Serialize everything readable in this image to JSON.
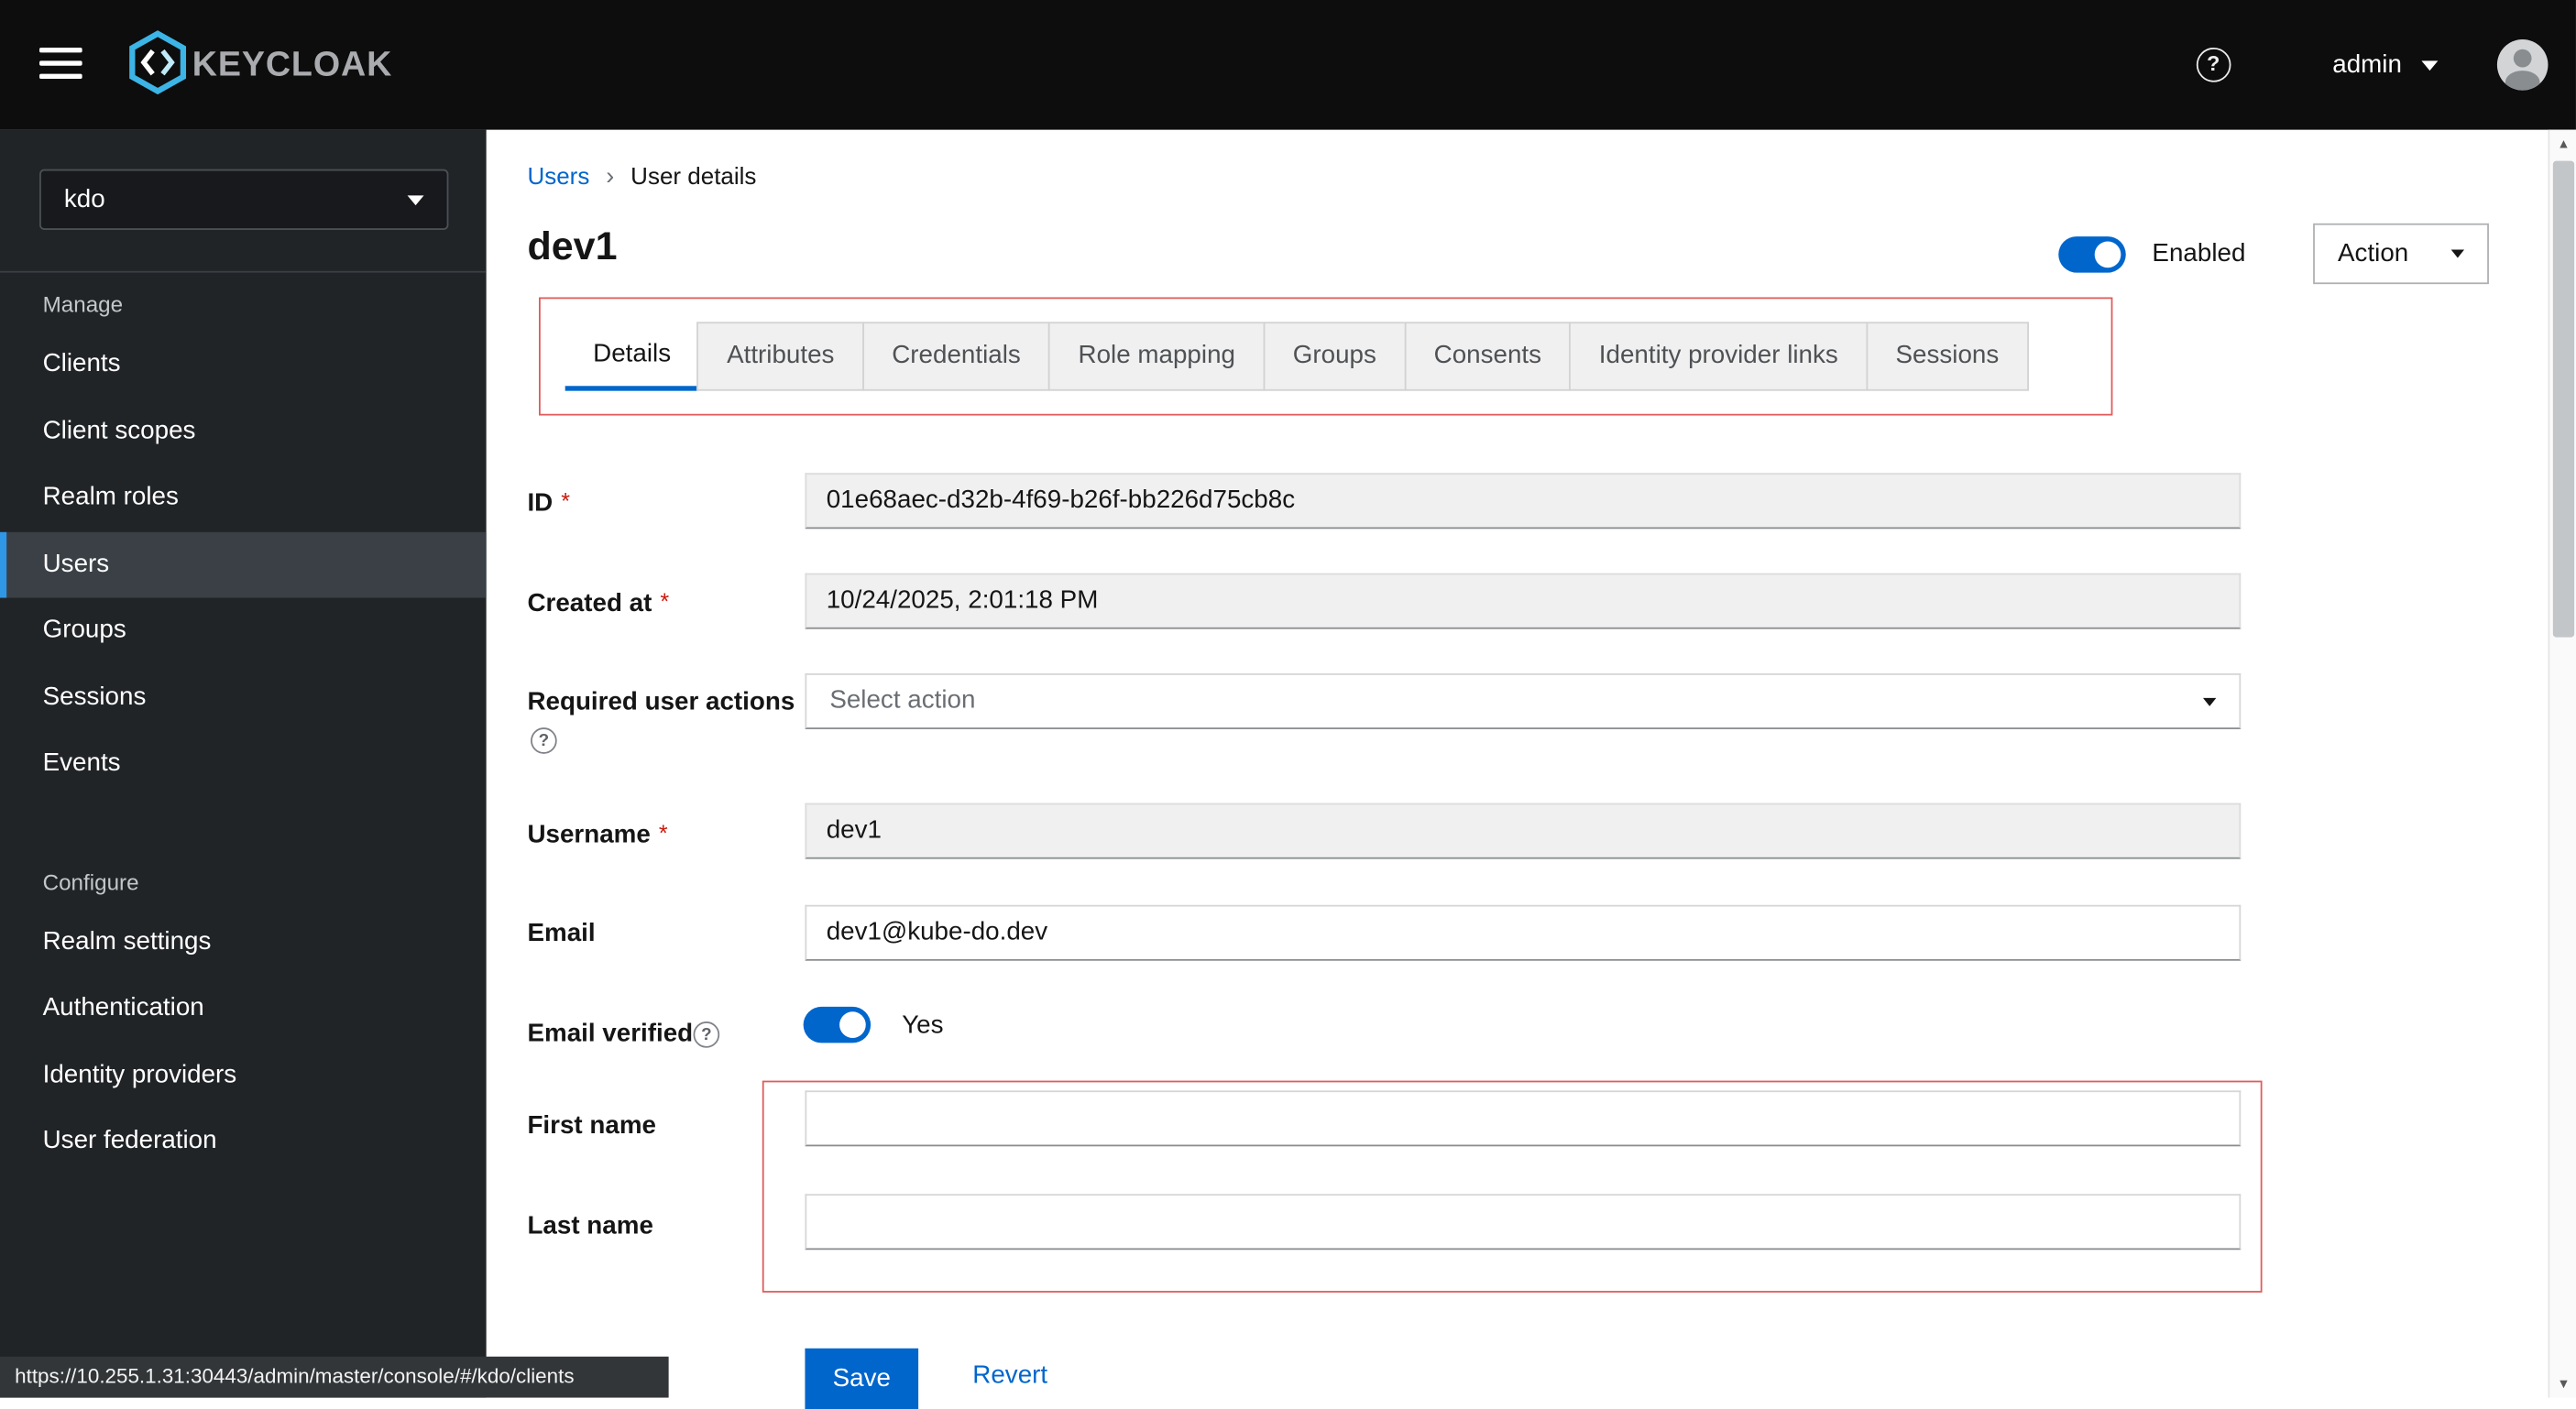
{
  "header": {
    "brand": "KEYCLOAK",
    "user_menu": "admin"
  },
  "icons": {
    "question": "?",
    "scroll_up": "▲",
    "scroll_down": "▼",
    "breadcrumb_separator": "›"
  },
  "sidebar": {
    "realm": "kdo",
    "sections": [
      {
        "label": "Manage",
        "items": [
          {
            "label": "Clients"
          },
          {
            "label": "Client scopes"
          },
          {
            "label": "Realm roles"
          },
          {
            "label": "Users",
            "active": true
          },
          {
            "label": "Groups"
          },
          {
            "label": "Sessions"
          },
          {
            "label": "Events"
          }
        ]
      },
      {
        "label": "Configure",
        "items": [
          {
            "label": "Realm settings"
          },
          {
            "label": "Authentication"
          },
          {
            "label": "Identity providers"
          },
          {
            "label": "User federation"
          }
        ]
      }
    ]
  },
  "breadcrumb": {
    "items": [
      "Users",
      "User details"
    ]
  },
  "page": {
    "title": "dev1",
    "enabled_label": "Enabled",
    "action_label": "Action"
  },
  "tabs": [
    {
      "label": "Details",
      "active": true
    },
    {
      "label": "Attributes"
    },
    {
      "label": "Credentials"
    },
    {
      "label": "Role mapping"
    },
    {
      "label": "Groups"
    },
    {
      "label": "Consents"
    },
    {
      "label": "Identity provider links"
    },
    {
      "label": "Sessions"
    }
  ],
  "form": {
    "id": {
      "label": "ID",
      "required": "*",
      "value": "01e68aec-d32b-4f69-b26f-bb226d75cb8c"
    },
    "created_at": {
      "label": "Created at",
      "required": "*",
      "value": "10/24/2025, 2:01:18 PM"
    },
    "required_actions": {
      "label": "Required user actions",
      "placeholder": "Select action"
    },
    "username": {
      "label": "Username",
      "required": "*",
      "value": "dev1"
    },
    "email": {
      "label": "Email",
      "value": "dev1@kube-do.dev"
    },
    "email_verified": {
      "label": "Email verified",
      "state": "Yes"
    },
    "first_name": {
      "label": "First name",
      "value": ""
    },
    "last_name": {
      "label": "Last name",
      "value": ""
    }
  },
  "actions": {
    "save": "Save",
    "revert": "Revert"
  },
  "status_bar": {
    "url": "https://10.255.1.31:30443/admin/master/console/#/kdo/clients"
  },
  "colors": {
    "accent": "#0066cc",
    "masthead": "#0d0d0d",
    "sidebar": "#212427",
    "nav_active_indicator": "#3096e6",
    "annotation": "#e05c5c",
    "readonly_bg": "#f0f0f0",
    "required_star": "#c9190b"
  }
}
